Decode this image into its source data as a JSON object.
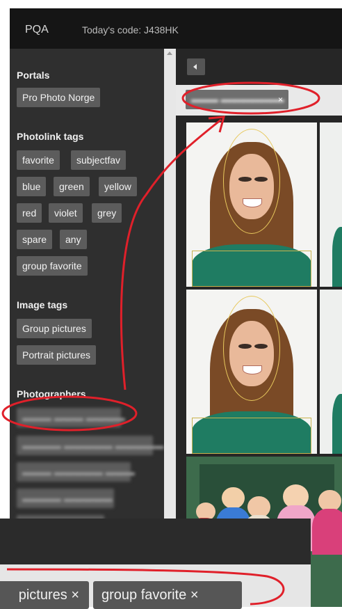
{
  "header": {
    "app_title": "PQA",
    "code_text": "Today's code: J438HK"
  },
  "sidebar": {
    "portals_title": "Portals",
    "portals": [
      "Pro Photo Norge"
    ],
    "photolink_title": "Photolink tags",
    "photolink_tags": [
      "favorite",
      "subjectfav",
      "blue",
      "green",
      "yellow",
      "red",
      "violet",
      "grey",
      "spare",
      "any",
      "group favorite"
    ],
    "image_tags_title": "Image tags",
    "image_tags": [
      "Group pictures",
      "Portrait pictures"
    ],
    "photographers_title": "Photographers"
  },
  "content": {
    "filter_x": "×"
  },
  "bottom_zoom": {
    "tag1": "pictures ×",
    "tag2": "group favorite ×"
  },
  "colors": {
    "highlight": "#e0202a",
    "tag_bg": "#5c5c5c",
    "sidebar_bg": "#2f2f2f"
  }
}
